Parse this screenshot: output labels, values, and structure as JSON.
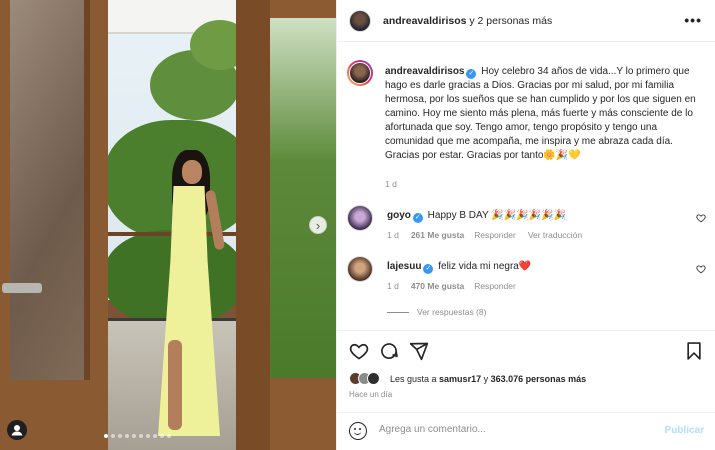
{
  "header": {
    "username": "andreavaldirisos",
    "suffix": " y 2 personas más",
    "more": "•••"
  },
  "caption": {
    "username": "andreavaldirisos",
    "text": "Hoy celebro 34 años de vida...Y lo primero que hago es darle gracias a Dios. Gracias por mi salud, por mi familia hermosa, por los sueños que se han cumplido y por los que siguen en camino. Hoy me siento más plena, más fuerte y más consciente de lo afortunada que soy. Tengo amor, tengo propósito y tengo una comunidad que me acompaña, me inspira y me abraza cada día. Gracias por estar. Gracias por tanto🌼🎉💛",
    "time": "1 d"
  },
  "comments": [
    {
      "username": "goyo",
      "text": "Happy B DAY 🎉🎉🎉🎉🎉🎉",
      "time": "1 d",
      "likes": "261 Me gusta",
      "reply": "Responder",
      "translation": "Ver traducción",
      "avatar_color": "#3a2a4a"
    },
    {
      "username": "lajesuu",
      "text": "feliz vida mi negra❤️",
      "time": "1 d",
      "likes": "470 Me gusta",
      "reply": "Responder",
      "avatar_color": "#6a4a3a"
    }
  ],
  "view_replies": "Ver respuestas (8)",
  "likes": {
    "prefix": "Les gusta a ",
    "user": "samusr17",
    "middle": " y ",
    "count": "363.076 personas más"
  },
  "posted": "Hace un día",
  "composer": {
    "placeholder": "Agrega un comentario...",
    "publish": "Publicar"
  },
  "carousel": {
    "total": 10,
    "active_index": 0
  },
  "icons": {
    "like": "heart-icon",
    "comment": "comment-icon",
    "share": "share-icon",
    "save": "bookmark-icon",
    "next": "chevron-right-icon",
    "tagged": "person-icon",
    "emoji": "emoji-icon"
  },
  "colors": {
    "verified": "#3897f0",
    "publish": "#b2dffc",
    "text": "#262626",
    "secondary": "#8e8e8e",
    "dress": "#eef19a"
  }
}
